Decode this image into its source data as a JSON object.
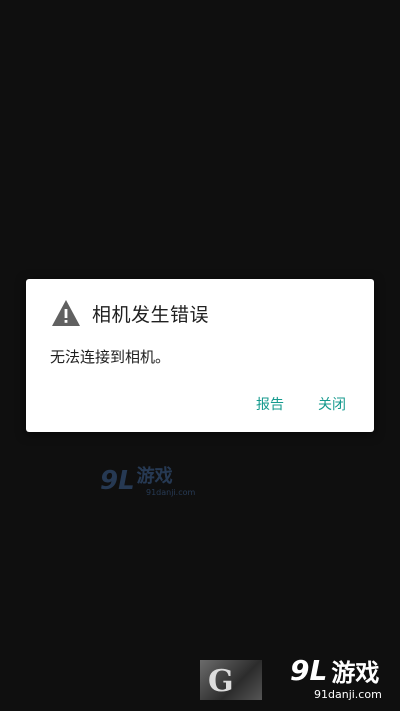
{
  "dialog": {
    "title": "相机发生错误",
    "message": "无法连接到相机。",
    "buttons": {
      "report": "报告",
      "close": "关闭"
    },
    "icon": "warning-icon",
    "accent_color": "#159a8e"
  },
  "watermark_center": {
    "logo": "9L",
    "name": "游戏",
    "url": "91danji.com"
  },
  "watermark_corner": {
    "logo": "9L",
    "name": "游戏",
    "url": "91danji.com",
    "thumb_letter": "G"
  },
  "colors": {
    "background": "#0f0f0f",
    "dialog_bg": "#ffffff",
    "text": "#202020"
  }
}
